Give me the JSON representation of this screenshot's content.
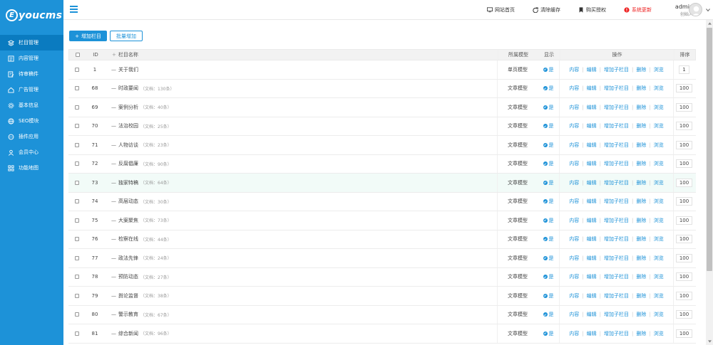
{
  "brand": {
    "logo_letter": "E",
    "logo_text": "youcms"
  },
  "sidebar": {
    "items": [
      {
        "label": "栏目管理",
        "icon": "layers-icon",
        "active": true
      },
      {
        "label": "内容管理",
        "icon": "list-icon"
      },
      {
        "label": "待审稿件",
        "icon": "doc-edit-icon"
      },
      {
        "label": "广告管理",
        "icon": "home-icon"
      },
      {
        "label": "基本信息",
        "icon": "gear-icon"
      },
      {
        "label": "SEO模块",
        "icon": "globe-icon"
      },
      {
        "label": "插件应用",
        "icon": "plug-icon"
      },
      {
        "label": "会员中心",
        "icon": "user-icon"
      },
      {
        "label": "功能地图",
        "icon": "grid-icon"
      }
    ]
  },
  "header": {
    "links": [
      {
        "label": "网站首页",
        "icon": "monitor-icon"
      },
      {
        "label": "清除缓存",
        "icon": "refresh-icon"
      },
      {
        "label": "购买授权",
        "icon": "bookmark-icon"
      },
      {
        "label": "系统更新",
        "icon": "alert-icon"
      }
    ],
    "user": {
      "name": "admin",
      "role": "创始人"
    }
  },
  "toolbar": {
    "add_label": "增加栏目",
    "add_plus": "+",
    "batch_label": "批量增加"
  },
  "table": {
    "headers": {
      "id": "ID",
      "name": "栏目名称",
      "name_plus": "+",
      "model": "所属模型",
      "show": "显示",
      "ops": "操作",
      "sort": "排序"
    },
    "prefix": "—",
    "show_text": "是",
    "ops": [
      "内容",
      "编辑",
      "增加子栏目",
      "删除",
      "浏览"
    ],
    "rows": [
      {
        "id": "1",
        "name": "关于我们",
        "docs": "",
        "model": "单页模型",
        "sort": "1"
      },
      {
        "id": "68",
        "name": "时政要闻",
        "docs": "（文档：130条）",
        "model": "文章模型",
        "sort": "100"
      },
      {
        "id": "69",
        "name": "案例分析",
        "docs": "（文档：40条）",
        "model": "文章模型",
        "sort": "100"
      },
      {
        "id": "70",
        "name": "法治校园",
        "docs": "（文档：25条）",
        "model": "文章模型",
        "sort": "100"
      },
      {
        "id": "71",
        "name": "人物访谈",
        "docs": "（文档：23条）",
        "model": "文章模型",
        "sort": "100"
      },
      {
        "id": "72",
        "name": "反腐倡廉",
        "docs": "（文档：90条）",
        "model": "文章模型",
        "sort": "100"
      },
      {
        "id": "73",
        "name": "独家特稿",
        "docs": "（文档：64条）",
        "model": "文章模型",
        "sort": "100",
        "highlight": true
      },
      {
        "id": "74",
        "name": "高层动态",
        "docs": "（文档：30条）",
        "model": "文章模型",
        "sort": "100"
      },
      {
        "id": "75",
        "name": "大案聚焦",
        "docs": "（文档：73条）",
        "model": "文章模型",
        "sort": "100"
      },
      {
        "id": "76",
        "name": "检察在线",
        "docs": "（文档：44条）",
        "model": "文章模型",
        "sort": "100"
      },
      {
        "id": "77",
        "name": "政法先锋",
        "docs": "（文档：24条）",
        "model": "文章模型",
        "sort": "100"
      },
      {
        "id": "78",
        "name": "预防动态",
        "docs": "（文档：27条）",
        "model": "文章模型",
        "sort": "100"
      },
      {
        "id": "79",
        "name": "舆论监督",
        "docs": "（文档：38条）",
        "model": "文章模型",
        "sort": "100"
      },
      {
        "id": "80",
        "name": "警示教育",
        "docs": "（文档：67条）",
        "model": "文章模型",
        "sort": "100"
      },
      {
        "id": "81",
        "name": "综合新闻",
        "docs": "（文档：96条）",
        "model": "文章模型",
        "sort": "100"
      }
    ]
  },
  "colors": {
    "accent": "#1d92d8",
    "sidebar_active": "#0a7bc0",
    "alert": "#ee2222"
  }
}
